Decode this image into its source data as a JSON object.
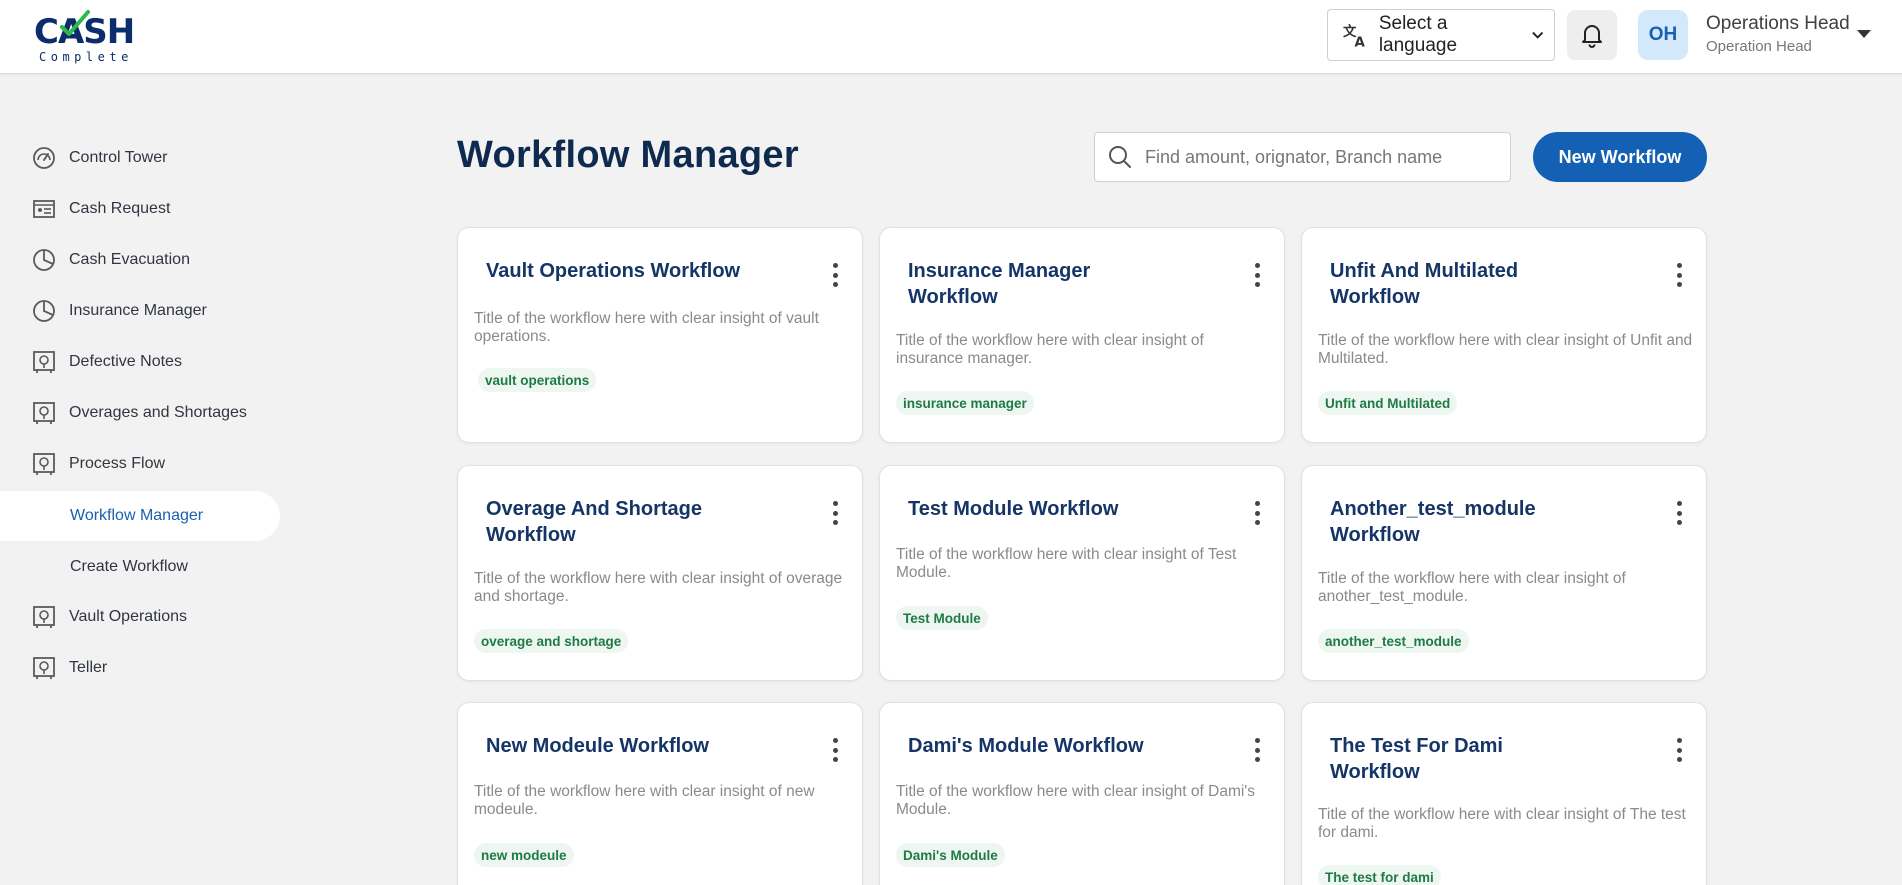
{
  "app": {
    "logo_text": "CASH",
    "logo_subtext": "Complete"
  },
  "header": {
    "language_label": "Select a language",
    "avatar_initials": "OH",
    "user_name": "Operations Head",
    "user_role": "Operation Head"
  },
  "sidebar": {
    "items": [
      {
        "label": "Control Tower",
        "icon": "gauge-icon"
      },
      {
        "label": "Cash Request",
        "icon": "id-card-icon"
      },
      {
        "label": "Cash Evacuation",
        "icon": "pie-chart-icon"
      },
      {
        "label": "Insurance Manager",
        "icon": "pie-chart-icon"
      },
      {
        "label": "Defective Notes",
        "icon": "vault-icon"
      },
      {
        "label": "Overages and Shortages",
        "icon": "vault-icon"
      },
      {
        "label": "Process Flow",
        "icon": "vault-icon"
      },
      {
        "label": "Workflow Manager",
        "active": true
      },
      {
        "label": "Create Workflow"
      },
      {
        "label": "Vault Operations",
        "icon": "vault-icon"
      },
      {
        "label": "Teller",
        "icon": "vault-icon"
      }
    ]
  },
  "main": {
    "title": "Workflow Manager",
    "search_placeholder": "Find amount, orignator, Branch name",
    "new_button_label": "New Workflow",
    "accent_color": "#1460b4",
    "tag_color": "#1f7a44",
    "cards": [
      {
        "title": "Vault Operations Workflow",
        "description": "Title of the workflow here with clear insight of vault operations.",
        "tag": "vault operations"
      },
      {
        "title": "Insurance Manager Workflow",
        "description": "Title of the workflow here with clear insight of insurance manager.",
        "tag": "insurance manager"
      },
      {
        "title": "Unfit And Multilated Workflow",
        "description": "Title of the workflow here with clear insight of Unfit and Multilated.",
        "tag": "Unfit and Multilated"
      },
      {
        "title": "Overage And Shortage Workflow",
        "description": "Title of the workflow here with clear insight of overage and shortage.",
        "tag": "overage and shortage"
      },
      {
        "title": "Test Module Workflow",
        "description": "Title of the workflow here with clear insight of Test Module.",
        "tag": "Test Module"
      },
      {
        "title": "Another_test_module Workflow",
        "description": "Title of the workflow here with clear insight of another_test_module.",
        "tag": "another_test_module"
      },
      {
        "title": "New Modeule Workflow",
        "description": "Title of the workflow here with clear insight of new modeule.",
        "tag": "new modeule"
      },
      {
        "title": "Dami's Module Workflow",
        "description": "Title of the workflow here with clear insight of Dami's Module.",
        "tag": "Dami's Module"
      },
      {
        "title": "The Test For Dami Workflow",
        "description": "Title of the workflow here with clear insight of The test for dami.",
        "tag": "The test for dami"
      }
    ]
  }
}
